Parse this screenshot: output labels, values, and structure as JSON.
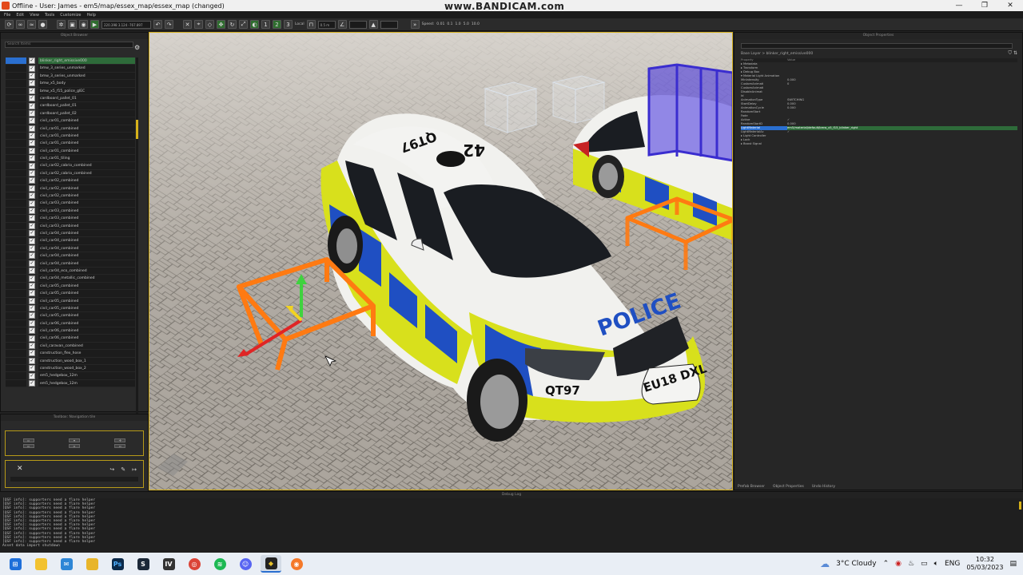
{
  "window": {
    "title": "Offline - User: James - em5/map/essex_map/essex_map (changed)",
    "watermark": "www.BANDICAM.com",
    "controls": [
      "—",
      "❐",
      "✕"
    ]
  },
  "menu": [
    "File",
    "Edit",
    "View",
    "Tools",
    "Customize",
    "Help"
  ],
  "toolbar": {
    "coords": "220.398 3.124 -767.897",
    "local_label": "Local",
    "snap_value": "0.5 m",
    "speed_label": "Speed:",
    "speed_values": [
      "0.01",
      "0.1",
      "1.0",
      "5.0",
      "10.0"
    ]
  },
  "object_browser": {
    "title": "Object Browser",
    "search_placeholder": "Search Items",
    "items": [
      "blinker_right_emissive000",
      "bmw_3_series_unmarked",
      "bmw_3_series_unmarked",
      "bmw_x5_body",
      "bmw_x5_f15_police_glEC",
      "cardboard_pallet_01",
      "cardboard_pallet_01",
      "cardboard_pallet_02",
      "civil_car01_combined",
      "civil_car01_combined",
      "civil_car01_combined",
      "civil_car01_combined",
      "civil_car01_combined",
      "civil_car01_tiling",
      "civil_car02_cabrio_combined",
      "civil_car02_cabrio_combined",
      "civil_car02_combined",
      "civil_car02_combined",
      "civil_car02_combined",
      "civil_car03_combined",
      "civil_car03_combined",
      "civil_car03_combined",
      "civil_car03_combined",
      "civil_car04_combined",
      "civil_car04_combined",
      "civil_car04_combined",
      "civil_car04_combined",
      "civil_car04_combined",
      "civil_car04_eco_combined",
      "civil_car04_metallic_combined",
      "civil_car05_combined",
      "civil_car05_combined",
      "civil_car05_combined",
      "civil_car05_combined",
      "civil_car05_combined",
      "civil_car06_combined",
      "civil_car06_combined",
      "civil_car06_combined",
      "civil_caravan_combined",
      "construction_flex_hose",
      "construction_wood_box_1",
      "construction_wood_box_2",
      "em5_hedgebox_12m",
      "em5_hedgebox_12m"
    ]
  },
  "nav_panel": {
    "title": "Toolbox: Navigation tile"
  },
  "object_properties": {
    "title": "Object Properties",
    "search_placeholder": "Search Items",
    "path": "Base Layer > blinker_right_emissive000",
    "columns": [
      "Property",
      "Value"
    ],
    "rows": [
      {
        "k": "▸ Metadata",
        "v": ""
      },
      {
        "k": "▸ Transform",
        "v": ""
      },
      {
        "k": "▸ Debug Box",
        "v": ""
      },
      {
        "k": "▾ Material Light Animation",
        "v": ""
      },
      {
        "k": "   MinIntensity",
        "v": "0.000"
      },
      {
        "k": "   CustomAnimati",
        "v": "0"
      },
      {
        "k": "   CustomAnimati",
        "v": ""
      },
      {
        "k": "   DisableAnimat",
        "v": ""
      },
      {
        "k": "   Id",
        "v": ""
      },
      {
        "k": "   AnimationType",
        "v": "SWITCHING"
      },
      {
        "k": "   StartDelay",
        "v": "0.000"
      },
      {
        "k": "   AnimationCycle",
        "v": "0.000"
      },
      {
        "k": "   RandomStart",
        "v": ""
      },
      {
        "k": "   Fade",
        "v": ""
      },
      {
        "k": "   Active",
        "v": "✓"
      },
      {
        "k": "   RandomStartD",
        "v": "0.000"
      },
      {
        "k": "   LightMaterial",
        "v": "em5/material/default/bmw_x5_f15_blinker_right"
      },
      {
        "k": "   LightMaterialAc",
        "v": "✓"
      },
      {
        "k": "▸ Light Controller",
        "v": ""
      },
      {
        "k": "▸ Lock",
        "v": ""
      },
      {
        "k": "▸ Boost Signal",
        "v": ""
      }
    ],
    "tabs": [
      "Prefab Browser",
      "Object Properties",
      "Undo History"
    ]
  },
  "debug_log": {
    "title": "Debug Log",
    "lines": [
      "[QSF info]: supporters need a flare helper",
      "[QSF info]: supporters need a flare helper",
      "[QSF info]: supporters need a flare helper",
      "[QSF info]: supporters need a flare helper",
      "[QSF info]: supporters need a flare helper",
      "[QSF info]: supporters need a flare helper",
      "[QSF info]: supporters need a flare helper",
      "[QSF info]: supporters need a flare helper",
      "[QSF info]: supporters need a flare helper",
      "[QSF info]: supporters need a flare helper",
      "[QSF info]: supporters need a flare helper",
      "Asset data import shutdown"
    ]
  },
  "scene": {
    "car_text": "POLICE",
    "plate": "EU18 DXL",
    "side_code": "QT97",
    "roof_code": "QT97",
    "roof_number": "42",
    "colors": {
      "yellow": "#d8e01c",
      "blue": "#1f4fc2",
      "white": "#f1f1ee",
      "orange": "#ff7a12",
      "floor": "#a9a39b"
    }
  },
  "taskbar": {
    "apps": [
      "windows-start",
      "file-explorer",
      "mail",
      "files",
      "photoshop",
      "steam",
      "editor",
      "chrome",
      "spotify",
      "discord",
      "game-editor",
      "blender"
    ],
    "weather": "3°C  Cloudy",
    "lang": "ENG",
    "time": "10:32",
    "date": "05/03/2023"
  }
}
